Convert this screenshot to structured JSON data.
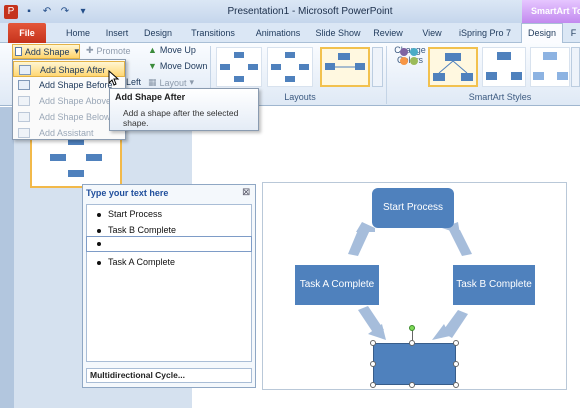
{
  "window": {
    "title": "Presentation1 - Microsoft PowerPoint",
    "context_tab": "SmartArt Too"
  },
  "tabs": {
    "file": "File",
    "list": [
      "Home",
      "Insert",
      "Design",
      "Transitions",
      "Animations",
      "Slide Show",
      "Review",
      "View",
      "iSpring Pro 7"
    ],
    "active": "Design",
    "extra": "F"
  },
  "ribbon": {
    "add_shape": "Add Shape",
    "promote": "Promote",
    "move_up": "Move Up",
    "move_down": "Move Down",
    "left": "Left",
    "layout": "Layout",
    "layouts_label": "Layouts",
    "change_colors_1": "Change",
    "change_colors_2": "Colors",
    "styles_label": "SmartArt Styles"
  },
  "menu": {
    "items": [
      {
        "label": "Add Shape After",
        "state": "highlighted"
      },
      {
        "label": "Add Shape Before",
        "state": "normal"
      },
      {
        "label": "Add Shape Above",
        "state": "disabled"
      },
      {
        "label": "Add Shape Below",
        "state": "disabled"
      },
      {
        "label": "Add Assistant",
        "state": "disabled"
      }
    ]
  },
  "tooltip": {
    "title": "Add Shape After",
    "body": "Add a shape after the selected shape."
  },
  "text_pane": {
    "title": "Type your text here",
    "items": [
      "Start Process",
      "Task B Complete",
      "",
      "Task A Complete"
    ],
    "footer": "Multidirectional Cycle..."
  },
  "smartart": {
    "start": "Start Process",
    "task_a": "Task A Complete",
    "task_b": "Task B Complete",
    "node_color": "#4f81bd",
    "arrow_color": "#a6bddb"
  },
  "icons": [
    "save-icon",
    "undo-icon",
    "redo-icon",
    "close-icon",
    "cursor-icon"
  ],
  "colors": {
    "accent": "#f2c14e",
    "file_tab": "#c5331c",
    "context": "#c289ef"
  }
}
